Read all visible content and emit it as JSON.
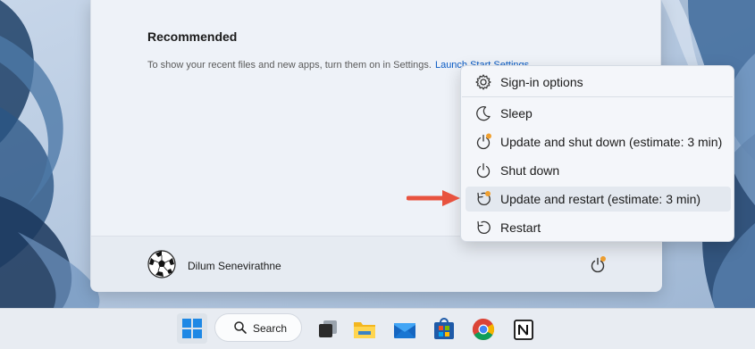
{
  "start_menu": {
    "recommended_title": "Recommended",
    "recommended_text": "To show your recent files and new apps, turn them on in Settings.",
    "recommended_link": "Launch Start Settings",
    "user_name": "Dilum Senevirathne"
  },
  "power_menu": {
    "items": [
      {
        "label": "Sign-in options",
        "icon": "gear-icon"
      },
      {
        "label": "Sleep",
        "icon": "moon-icon"
      },
      {
        "label": "Update and shut down (estimate: 3 min)",
        "icon": "power-update-icon"
      },
      {
        "label": "Shut down",
        "icon": "power-icon"
      },
      {
        "label": "Update and restart (estimate: 3 min)",
        "icon": "restart-update-icon",
        "highlighted": true
      },
      {
        "label": "Restart",
        "icon": "restart-icon"
      }
    ]
  },
  "taskbar": {
    "search_label": "Search",
    "apps": [
      "start-icon",
      "task-view-icon",
      "file-explorer-icon",
      "mail-icon",
      "microsoft-store-icon",
      "chrome-icon",
      "notion-icon"
    ]
  },
  "colors": {
    "accent_orange": "#f0a030",
    "arrow_red": "#e8533f",
    "link_blue": "#0a5bc4",
    "windows_blue": "#1e88e5"
  }
}
